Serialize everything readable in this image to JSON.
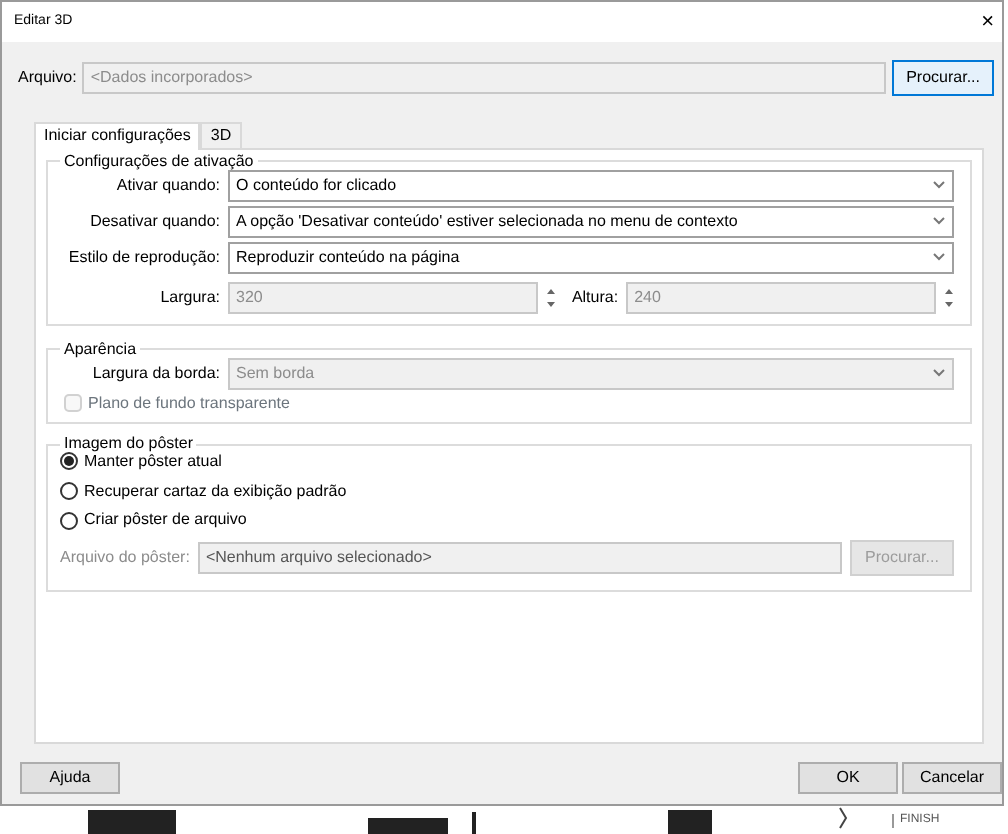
{
  "window": {
    "title": "Editar 3D",
    "close": "×"
  },
  "file": {
    "label": "Arquivo:",
    "value": "<Dados incorporados>",
    "button": "Procurar..."
  },
  "tabs": [
    {
      "label": "Iniciar configurações",
      "selected": true
    },
    {
      "label": "3D",
      "selected": false
    }
  ],
  "activation": {
    "title": "Configurações de ativação",
    "selects": [
      {
        "label": "Ativar quando:",
        "value": "O conteúdo for clicado",
        "disabled": false
      },
      {
        "label": "Desativar quando:",
        "value": "A opção 'Desativar conteúdo' estiver selecionada no menu de contexto",
        "disabled": false
      },
      {
        "label": "Estilo de reprodução:",
        "value": "Reproduzir conteúdo na página",
        "disabled": false
      }
    ],
    "width": {
      "label": "Largura:",
      "value": "320",
      "disabled": true
    },
    "height": {
      "label": "Altura:",
      "value": "240",
      "disabled": true
    }
  },
  "appearance": {
    "title": "Aparência",
    "border_width": {
      "label": "Largura da borda:",
      "value": "Sem borda",
      "disabled": true
    },
    "transparent": {
      "label": "Plano de fundo transparente",
      "checked": false,
      "disabled": true
    }
  },
  "poster": {
    "title": "Imagem do pôster",
    "options": [
      {
        "label": "Manter pôster atual",
        "selected": true
      },
      {
        "label": "Recuperar cartaz da exibição padrão",
        "selected": false
      },
      {
        "label": "Criar pôster de arquivo",
        "selected": false
      }
    ],
    "file": {
      "label": "Arquivo do pôster:",
      "value": "<Nenhum arquivo selecionado>",
      "button": "Procurar...",
      "disabled": true
    }
  },
  "footer": {
    "help": "Ajuda",
    "ok": "OK",
    "cancel": "Cancelar"
  },
  "background": {
    "label": "FINISH"
  }
}
